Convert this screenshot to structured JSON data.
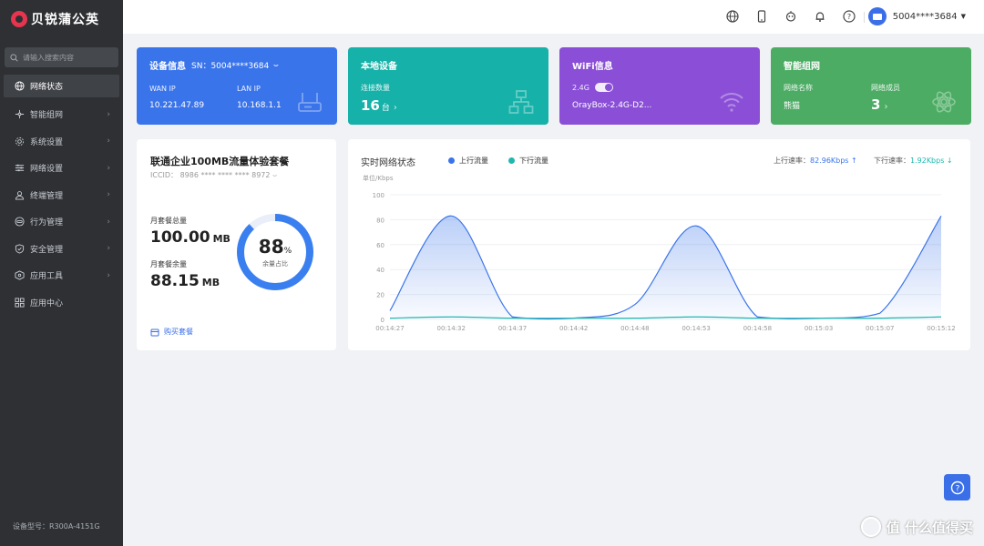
{
  "app": {
    "brand": "贝锐蒲公英"
  },
  "sidebar": {
    "search_placeholder": "请输入搜索内容",
    "items": [
      {
        "label": "网络状态",
        "icon": "globe-icon",
        "active": true
      },
      {
        "label": "智能组网",
        "icon": "mesh-icon"
      },
      {
        "label": "系统设置",
        "icon": "gear-icon"
      },
      {
        "label": "网络设置",
        "icon": "sliders-icon"
      },
      {
        "label": "终端管理",
        "icon": "user-icon"
      },
      {
        "label": "行为管理",
        "icon": "link-icon"
      },
      {
        "label": "安全管理",
        "icon": "shield-icon"
      },
      {
        "label": "应用工具",
        "icon": "box-icon"
      },
      {
        "label": "应用中心",
        "icon": "grid-icon"
      }
    ],
    "footer": "设备型号：R300A-4151G"
  },
  "header": {
    "username": "5004****3684"
  },
  "cards": {
    "device": {
      "title": "设备信息",
      "sn": "SN：5004****3684",
      "wan_label": "WAN IP",
      "wan_value": "10.221.47.89",
      "lan_label": "LAN IP",
      "lan_value": "10.168.1.1",
      "color": "#3a74ea"
    },
    "local": {
      "title": "本地设备",
      "label": "连接数量",
      "count": "16",
      "unit": "台",
      "color": "#16b1a8"
    },
    "wifi": {
      "title": "WiFi信息",
      "band": "2.4G",
      "ssid": "OrayBox-2.4G-D2...",
      "color": "#8a4fd6"
    },
    "mesh": {
      "title": "智能组网",
      "name_label": "网络名称",
      "name_value": "熊猫",
      "members_label": "网络成员",
      "members_value": "3",
      "color": "#4cac64"
    }
  },
  "plan": {
    "title": "联通企业100MB流量体验套餐",
    "iccid": "ICCID：  8986 **** **** **** 8972",
    "total_label": "月套餐总量",
    "total_value": "100.00",
    "total_unit": "MB",
    "remain_label": "月套餐余量",
    "remain_value": "88.15",
    "remain_unit": "MB",
    "percent": "88",
    "percent_unit": "%",
    "percent_label": "余量占比",
    "buy_label": "购买套餐"
  },
  "chart_data": {
    "type": "area",
    "title": "实时网络状态",
    "unit_label": "单位/Kbps",
    "ylim": [
      0,
      100
    ],
    "yticks": [
      0,
      20,
      40,
      60,
      80,
      100
    ],
    "x": [
      "00:14:27",
      "00:14:32",
      "00:14:37",
      "00:14:42",
      "00:14:48",
      "00:14:53",
      "00:14:58",
      "00:15:03",
      "00:15:07",
      "00:15:12"
    ],
    "series": [
      {
        "name": "上行流量",
        "color": "#3a74ea",
        "values": [
          7,
          83,
          2,
          1,
          12,
          75,
          2,
          1,
          5,
          83
        ]
      },
      {
        "name": "下行流量",
        "color": "#1fb8b0",
        "values": [
          1,
          2,
          1,
          1,
          1,
          2,
          1,
          1,
          1,
          2
        ]
      }
    ],
    "up_rate_label": "上行速率：",
    "up_rate_value": "82.96Kbps ↑",
    "down_rate_label": "下行速率：",
    "down_rate_value": "1.92Kbps ↓"
  },
  "watermark": "值 什么值得买"
}
